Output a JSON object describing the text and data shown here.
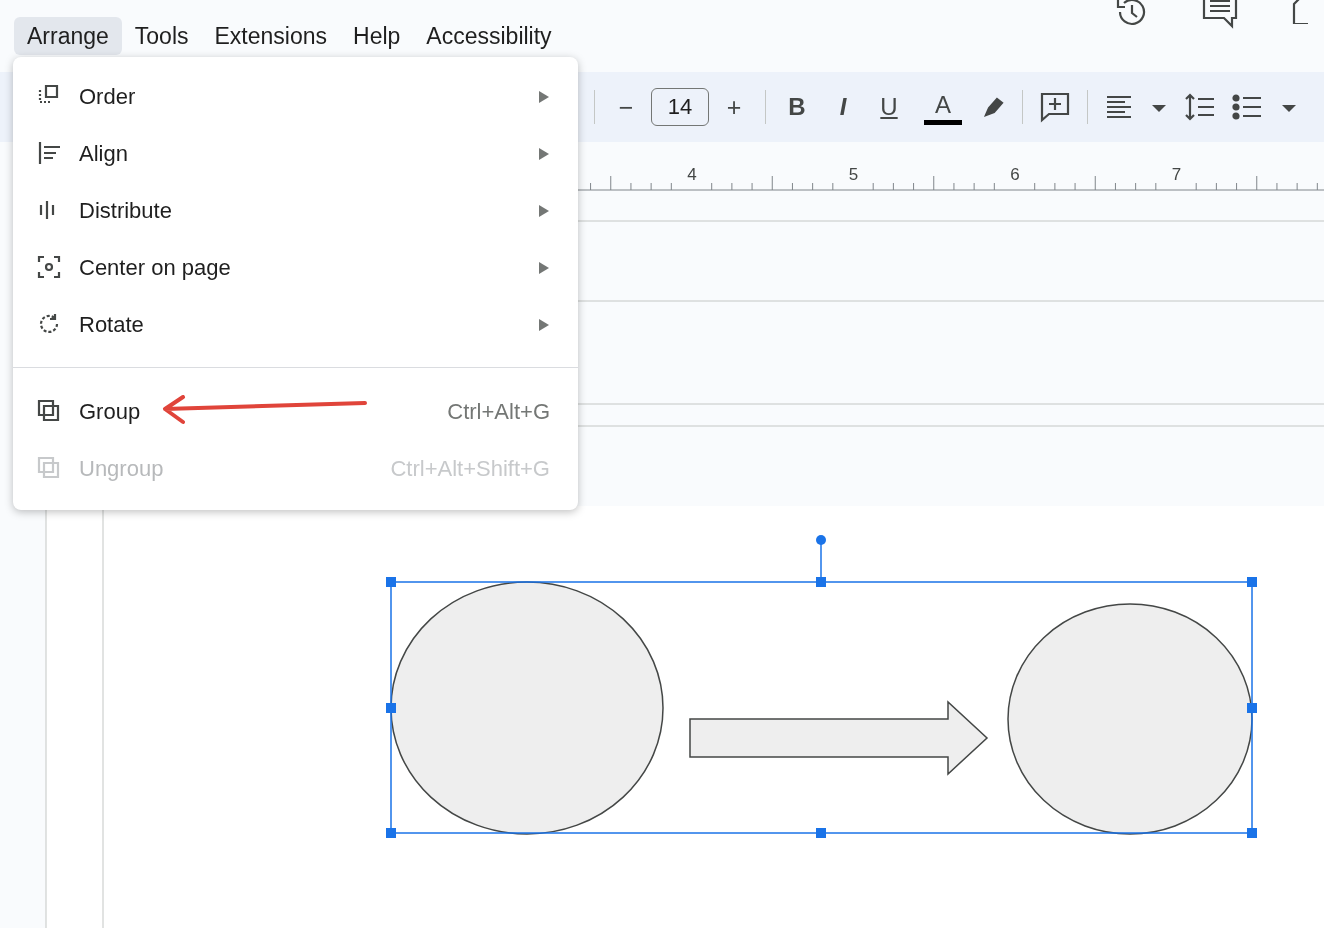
{
  "menubar": [
    {
      "label": "Arrange",
      "selected": true
    },
    {
      "label": "Tools",
      "selected": false
    },
    {
      "label": "Extensions",
      "selected": false
    },
    {
      "label": "Help",
      "selected": false
    },
    {
      "label": "Accessibility",
      "selected": false
    }
  ],
  "toolbar": {
    "items": [
      {
        "kind": "divider"
      },
      {
        "kind": "text",
        "label": "−"
      },
      {
        "kind": "field",
        "value": "14"
      },
      {
        "kind": "text",
        "label": "+"
      },
      {
        "kind": "divider"
      },
      {
        "kind": "text",
        "label": "B"
      },
      {
        "kind": "text",
        "label": "I"
      },
      {
        "kind": "text",
        "label": "U"
      },
      {
        "kind": "text",
        "label": "A"
      },
      {
        "kind": "icon"
      },
      {
        "kind": "divider"
      },
      {
        "kind": "icon"
      },
      {
        "kind": "divider"
      },
      {
        "kind": "icon"
      },
      {
        "kind": "icon"
      },
      {
        "kind": "icon"
      },
      {
        "kind": "icon"
      },
      {
        "kind": "icon"
      }
    ]
  },
  "ruler": {
    "labels": [
      "4",
      "5",
      "6",
      "7"
    ]
  },
  "menu": {
    "items": [
      {
        "label": "Order",
        "kind": "submenu",
        "disabled": false
      },
      {
        "label": "Align",
        "kind": "submenu",
        "disabled": false
      },
      {
        "label": "Distribute",
        "kind": "submenu",
        "disabled": false
      },
      {
        "label": "Center on page",
        "kind": "submenu",
        "disabled": false
      },
      {
        "label": "Rotate",
        "kind": "submenu",
        "disabled": false
      },
      {
        "kind": "divider"
      },
      {
        "label": "Group",
        "kind": "shortcut",
        "shortcut": "Ctrl+Alt+G",
        "disabled": false
      },
      {
        "label": "Ungroup",
        "kind": "shortcut",
        "shortcut": "Ctrl+Alt+Shift+G",
        "disabled": true
      }
    ]
  }
}
